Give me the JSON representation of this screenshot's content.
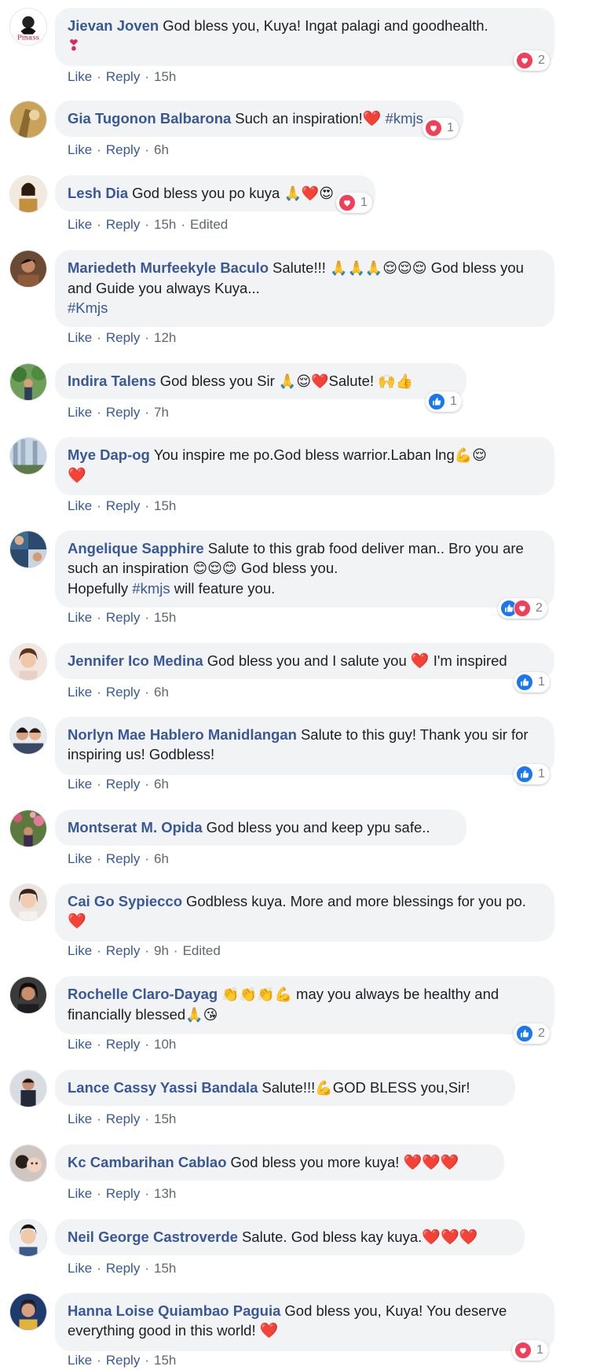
{
  "actions": {
    "like": "Like",
    "reply": "Reply",
    "dot": "·",
    "edited": "Edited"
  },
  "colors": {
    "link": "#385898",
    "bubble": "#f2f3f5",
    "love": "#f33e58",
    "like": "#1877f2"
  },
  "comments": [
    {
      "author": "Jievan Joven",
      "text": "God bless you, Kuya! Ingat palagi and goodhealth.",
      "emoji": "❣",
      "time": "15h",
      "reaction_count": "2",
      "avatar_text": "Pinass"
    },
    {
      "author": "Gia Tugonon Balbarona",
      "text": "Such an inspiration!",
      "emoji": "❤️",
      "hashtag": "#kmjs",
      "time": "6h",
      "reaction_count": "1"
    },
    {
      "author": "Lesh Dia",
      "text": "God bless you po kuya",
      "emoji": "🙏❤️😍",
      "time": "15h",
      "edited": "Edited",
      "reaction_count": "1"
    },
    {
      "author": "Mariedeth Murfeekyle Baculo",
      "text": "Salute!!!",
      "emoji": "🙏🙏🙏😌😌😌",
      "text2": "God bless you and Guide you always Kuya...",
      "hashtag": "#Kmjs",
      "time": "12h"
    },
    {
      "author": "Indira Talens",
      "text": "God bless you Sir",
      "emoji": "🙏😌❤️",
      "text2": "Salute!",
      "emoji2": "🙌👍",
      "time": "7h",
      "reaction_count": "1"
    },
    {
      "author": "Mye Dap-og",
      "text": "You inspire me po.God bless warrior.Laban lng",
      "emoji": "💪😌",
      "emoji2": "❤️",
      "time": "15h"
    },
    {
      "author": "Angelique Sapphire",
      "text": "Salute to this grab food deliver man.. Bro you are such an inspiration",
      "emoji": "😊😌😊",
      "text2": "God bless you.",
      "text3": "Hopefully",
      "hashtag": "#kmjs",
      "text4": "will feature you.",
      "time": "15h",
      "reaction_count": "2"
    },
    {
      "author": "Jennifer Ico Medina",
      "text": "God bless you and I salute you",
      "emoji": "❤️",
      "text2": "I'm inspired",
      "time": "6h",
      "reaction_count": "1"
    },
    {
      "author": "Norlyn Mae Hablero Manidlangan",
      "text": "Salute to this guy! Thank you sir for inspiring us! Godbless!",
      "time": "6h",
      "reaction_count": "1"
    },
    {
      "author": "Montserat M. Opida",
      "text": "God bless you and keep ypu safe..",
      "time": "6h"
    },
    {
      "author": "Cai Go Sypiecco",
      "text": "Godbless kuya. More and more blessings for you po.",
      "emoji": "❤️",
      "time": "9h",
      "edited": "Edited"
    },
    {
      "author": "Rochelle Claro-Dayag",
      "emoji": "👏👏👏💪",
      "text": "may you always be healthy and financially blessed",
      "emoji2": "🙏😘",
      "time": "10h",
      "reaction_count": "2"
    },
    {
      "author": "Lance Cassy Yassi Bandala",
      "text": "Salute!!!",
      "emoji": "💪",
      "text2": "GOD BLESS you,Sir!",
      "time": "15h"
    },
    {
      "author": "Kc Cambarihan Cablao",
      "text": "God bless you more kuya!",
      "emoji": "❤️❤️❤️",
      "time": "13h"
    },
    {
      "author": "Neil George Castroverde",
      "text": "Salute. God bless kay kuya.",
      "emoji": "❤️❤️❤️",
      "time": "15h"
    },
    {
      "author": "Hanna Loise Quiambao Paguia",
      "text": "God bless you, Kuya! You deserve everything good in this world!",
      "emoji": "❤️",
      "time": "15h",
      "reaction_count": "1"
    }
  ]
}
